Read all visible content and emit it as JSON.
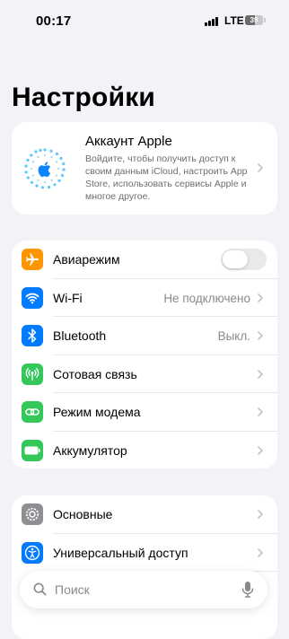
{
  "status_bar": {
    "time": "00:17",
    "network": "LTE",
    "battery": "39"
  },
  "title": "Настройки",
  "account": {
    "title": "Аккаунт Apple",
    "description": "Войдите, чтобы получить доступ к своим данным iCloud, настроить App Store, использовать сервисы Apple и многое другое."
  },
  "group1": [
    {
      "label": "Авиарежим",
      "icon": "airplane-icon",
      "color": "#ff9500",
      "toggle": false
    },
    {
      "label": "Wi-Fi",
      "value": "Не подключено",
      "icon": "wifi-icon",
      "color": "#007aff"
    },
    {
      "label": "Bluetooth",
      "value": "Выкл.",
      "icon": "bluetooth-icon",
      "color": "#007aff"
    },
    {
      "label": "Сотовая связь",
      "icon": "antenna-icon",
      "color": "#34c759"
    },
    {
      "label": "Режим модема",
      "icon": "chain-link-icon",
      "color": "#34c759"
    },
    {
      "label": "Аккумулятор",
      "icon": "battery-icon",
      "color": "#34c759"
    }
  ],
  "group2": [
    {
      "label": "Основные",
      "icon": "gear-icon",
      "color": "#8e8e93"
    },
    {
      "label": "Универсальный доступ",
      "icon": "accessibility-icon",
      "color": "#007aff"
    }
  ],
  "search": {
    "placeholder": "Поиск"
  }
}
